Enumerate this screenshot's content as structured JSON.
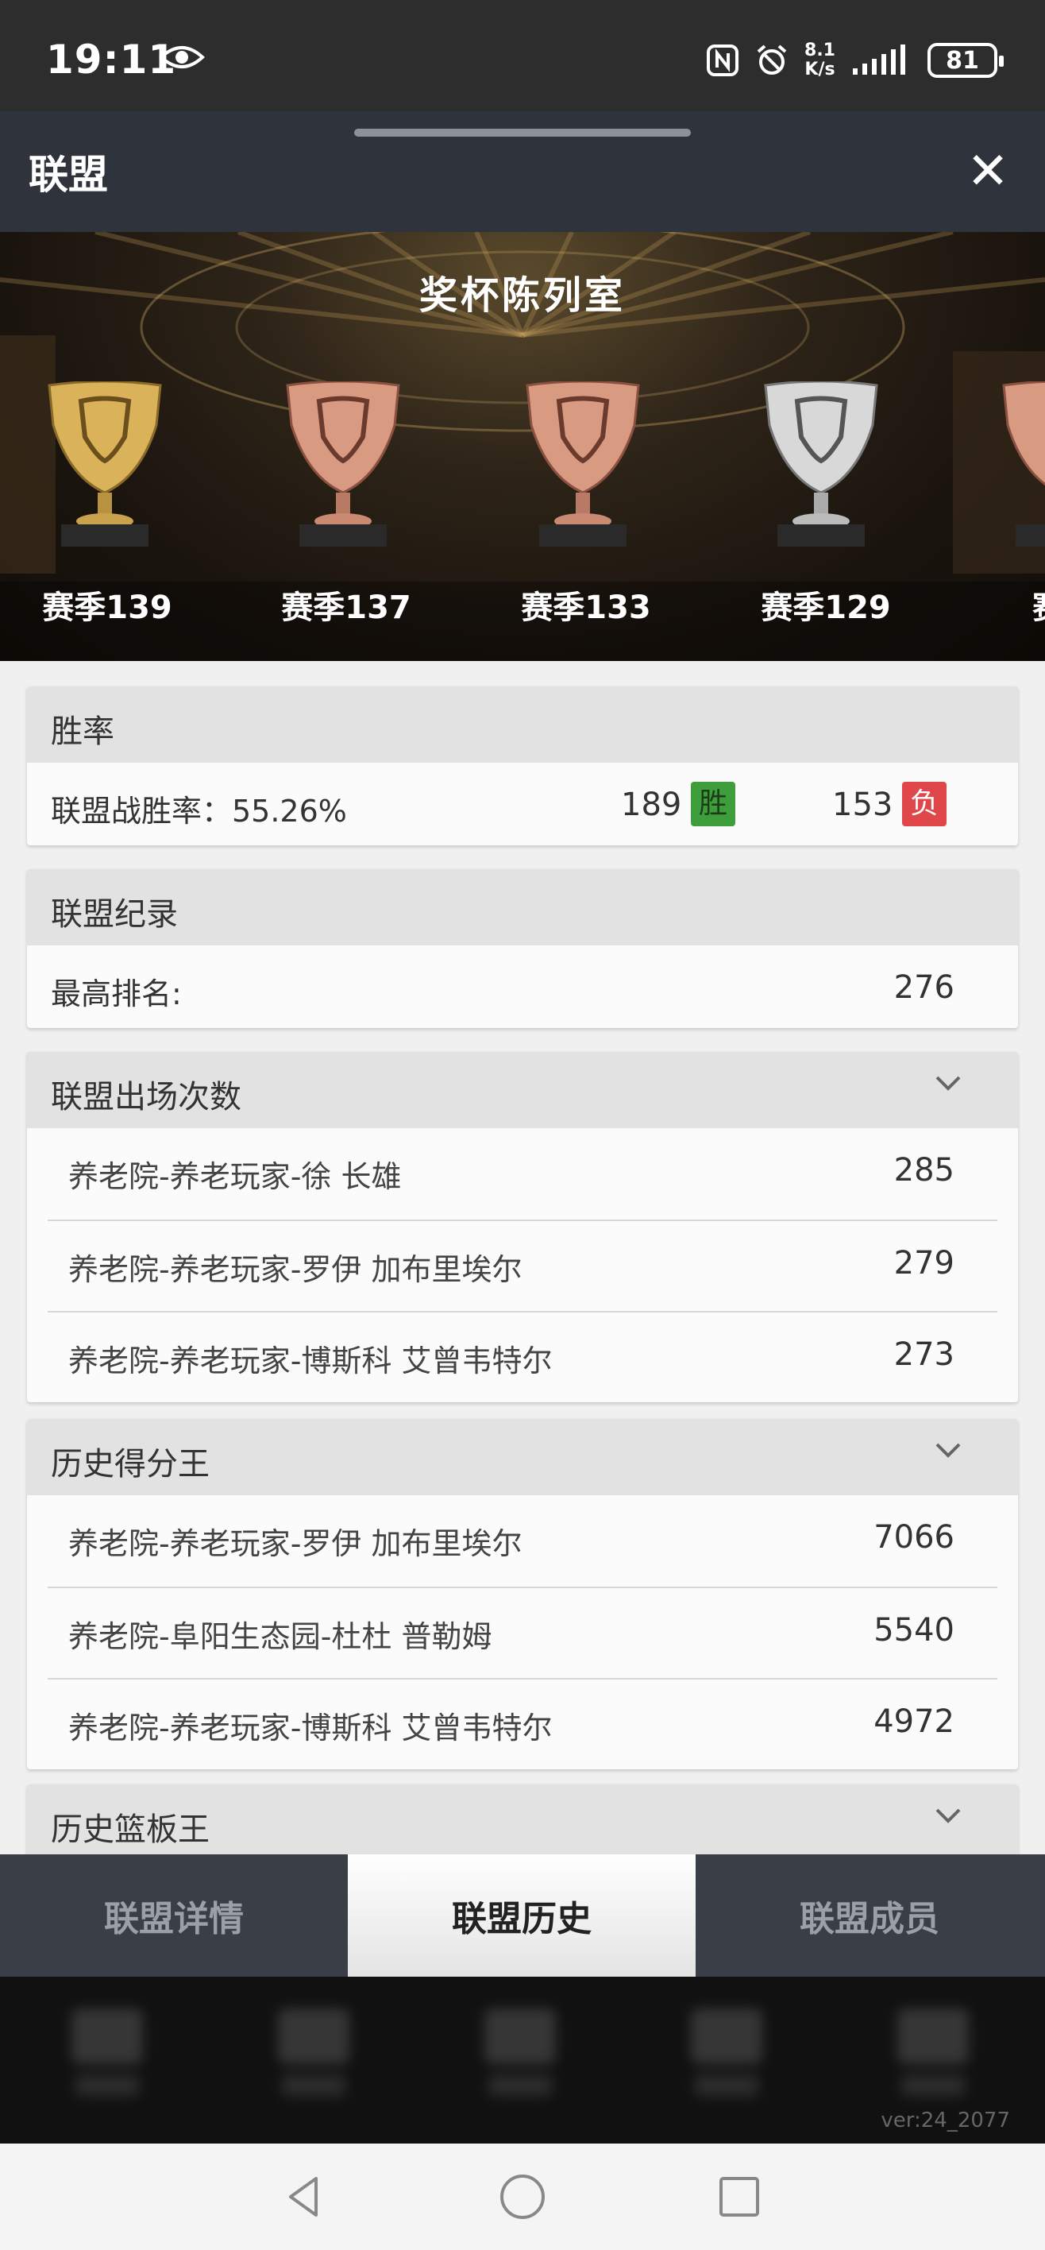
{
  "status_bar": {
    "time": "19:11",
    "net_speed_value": "8.1",
    "net_speed_unit": "K/s",
    "battery": "81",
    "icons": [
      "eye-icon",
      "nfc-icon",
      "alarm-icon",
      "signal-icon",
      "battery-icon"
    ]
  },
  "header": {
    "title": "联盟",
    "close_icon": "close-icon"
  },
  "banner": {
    "title": "奖杯陈列室",
    "trophies": [
      {
        "label": "赛季139",
        "tier": "gold"
      },
      {
        "label": "赛季137",
        "tier": "bronze"
      },
      {
        "label": "赛季133",
        "tier": "bronze"
      },
      {
        "label": "赛季129",
        "tier": "silver"
      },
      {
        "label": "赛季",
        "tier": "bronze"
      }
    ]
  },
  "win_rate": {
    "title": "胜率",
    "label": "联盟战胜率：55.26%",
    "wins": "189",
    "win_badge": "胜",
    "losses": "153",
    "loss_badge": "负"
  },
  "record": {
    "title": "联盟纪录",
    "best_rank_label": "最高排名:",
    "best_rank_value": "276"
  },
  "appearances": {
    "title": "联盟出场次数",
    "rows": [
      {
        "name": "养老院-养老玩家-徐 长雄",
        "value": "285"
      },
      {
        "name": "养老院-养老玩家-罗伊 加布里埃尔",
        "value": "279"
      },
      {
        "name": "养老院-养老玩家-博斯科 艾曾韦特尔",
        "value": "273"
      }
    ]
  },
  "scorers": {
    "title": "历史得分王",
    "rows": [
      {
        "name": "养老院-养老玩家-罗伊 加布里埃尔",
        "value": "7066"
      },
      {
        "name": "养老院-阜阳生态园-杜杜 普勒姆",
        "value": "5540"
      },
      {
        "name": "养老院-养老玩家-博斯科 艾曾韦特尔",
        "value": "4972"
      }
    ]
  },
  "rebounders": {
    "title": "历史篮板王"
  },
  "tabs": [
    {
      "label": "联盟详情",
      "active": false
    },
    {
      "label": "联盟历史",
      "active": true
    },
    {
      "label": "联盟成员",
      "active": false
    }
  ],
  "version": "ver:24_2077",
  "colors": {
    "win": "#3e9e3b",
    "loss": "#e0474a",
    "header_bg": "#2f343c",
    "gold": "#d9b25a",
    "bronze": "#d99a82",
    "silver": "#d8d8d8"
  }
}
